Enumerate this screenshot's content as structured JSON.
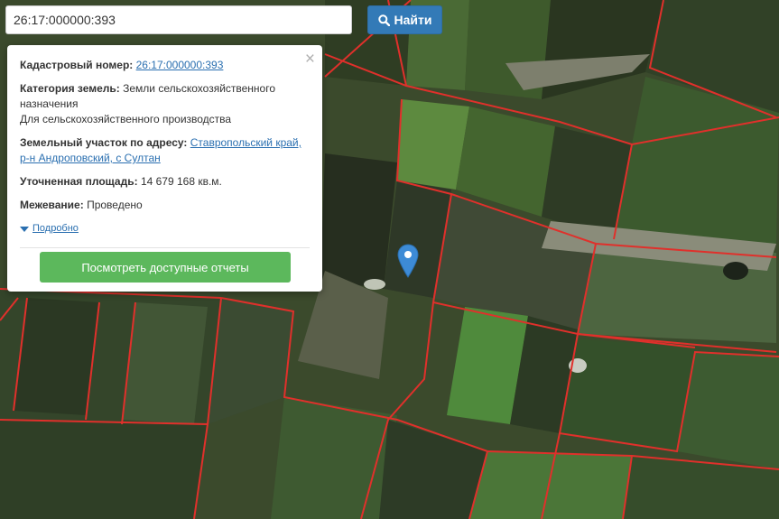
{
  "search": {
    "value": "26:17:000000:393",
    "button_label": "Найти"
  },
  "popup": {
    "cadastral_label": "Кадастровый номер:",
    "cadastral_value": "26:17:000000:393",
    "category_label": "Категория земель:",
    "category_value": "Земли сельскохозяйственного назначения",
    "usage_value": "Для сельскохозяйственного производства",
    "address_label": "Земельный участок по адресу:",
    "address_value": "Ставропольский край, р-н Андроповский, с Султан",
    "area_label": "Уточненная площадь:",
    "area_value": "14 679 168 кв.м.",
    "survey_label": "Межевание:",
    "survey_value": "Проведено",
    "details_label": "Подробно",
    "report_button_label": "Посмотреть доступные отчеты",
    "close_symbol": "×"
  },
  "map": {
    "parcel_border_color": "#e0302b",
    "marker_color": "#3d8bd6",
    "marker_icon": "map-pin-icon",
    "search_icon": "search-icon"
  }
}
